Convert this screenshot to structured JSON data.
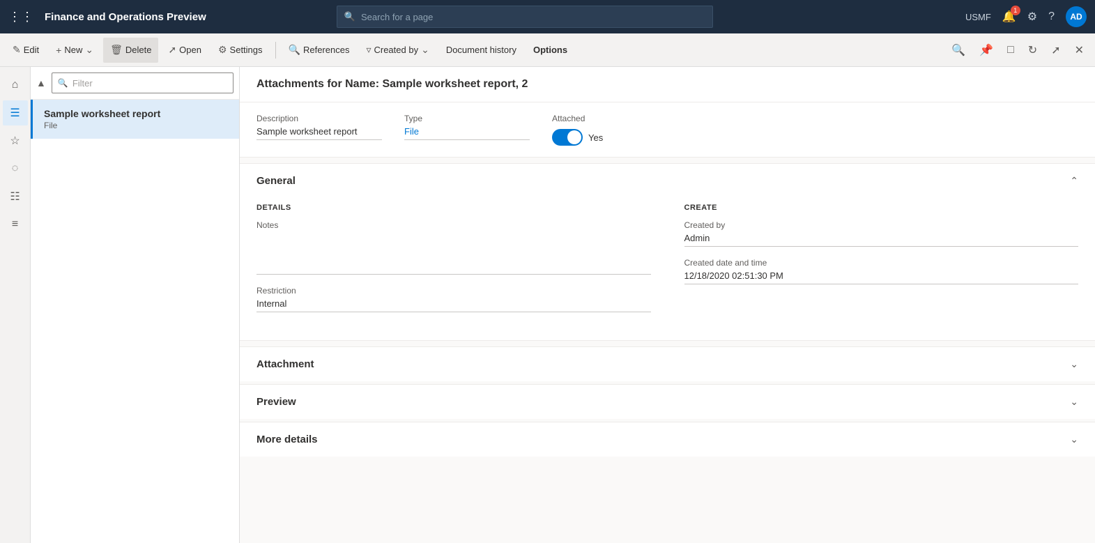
{
  "app": {
    "title": "Finance and Operations Preview",
    "org": "USMF",
    "avatar": "AD",
    "search_placeholder": "Search for a page",
    "notification_count": "1"
  },
  "toolbar": {
    "edit_label": "Edit",
    "new_label": "New",
    "delete_label": "Delete",
    "open_label": "Open",
    "settings_label": "Settings",
    "references_label": "References",
    "created_by_label": "Created by",
    "document_history_label": "Document history",
    "options_label": "Options"
  },
  "filter": {
    "placeholder": "Filter"
  },
  "list": {
    "items": [
      {
        "title": "Sample worksheet report",
        "subtitle": "File",
        "selected": true
      }
    ]
  },
  "detail": {
    "header": "Attachments for Name: Sample worksheet report, 2",
    "description_label": "Description",
    "description_value": "Sample worksheet report",
    "type_label": "Type",
    "type_value": "File",
    "attached_label": "Attached",
    "attached_toggle": true,
    "attached_value": "Yes"
  },
  "general_section": {
    "title": "General",
    "details_col_title": "DETAILS",
    "create_col_title": "CREATE",
    "notes_label": "Notes",
    "notes_value": "",
    "restriction_label": "Restriction",
    "restriction_value": "Internal",
    "created_by_label": "Created by",
    "created_by_value": "Admin",
    "created_date_label": "Created date and time",
    "created_date_value": "12/18/2020 02:51:30 PM"
  },
  "attachment_section": {
    "title": "Attachment"
  },
  "preview_section": {
    "title": "Preview"
  },
  "more_details_section": {
    "title": "More details"
  },
  "icons": {
    "grid": "⊞",
    "home": "⌂",
    "star": "☆",
    "recent": "🕐",
    "workspace": "⊟",
    "list": "≡",
    "filter": "⊤",
    "search": "🔍",
    "edit": "✎",
    "new_plus": "+",
    "delete": "🗑",
    "arrow": "→",
    "settings_gear": "⚙",
    "references_search": "🔍",
    "funnel": "⊿",
    "chevron_down": "∨",
    "chevron_up": "∧",
    "pin": "📌",
    "split": "⊡",
    "refresh": "↻",
    "popout": "⊡",
    "close": "✕",
    "bell": "🔔",
    "gear": "⚙",
    "question": "?"
  }
}
